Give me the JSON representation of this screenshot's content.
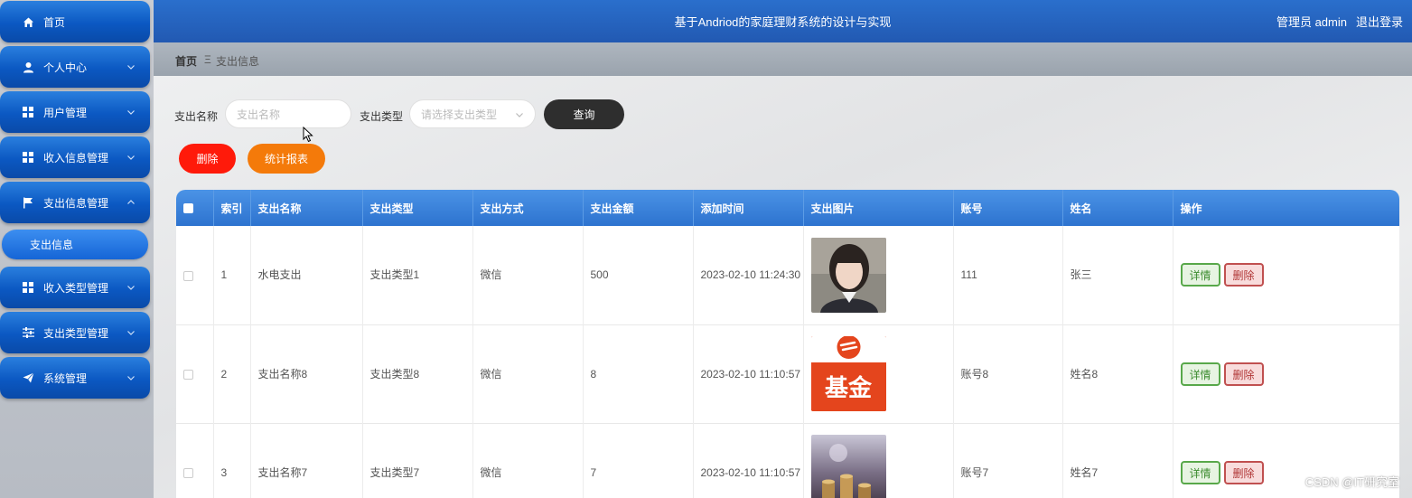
{
  "sidebar": {
    "items": [
      {
        "label": "首页",
        "icon": "home-icon"
      },
      {
        "label": "个人中心",
        "icon": "user-icon"
      },
      {
        "label": "用户管理",
        "icon": "grid-icon"
      },
      {
        "label": "收入信息管理",
        "icon": "grid-icon"
      },
      {
        "label": "支出信息管理",
        "icon": "flag-icon"
      },
      {
        "label": "收入类型管理",
        "icon": "grid-icon"
      },
      {
        "label": "支出类型管理",
        "icon": "sliders-icon"
      },
      {
        "label": "系统管理",
        "icon": "send-icon"
      }
    ],
    "active_sub": "支出信息"
  },
  "header": {
    "title": "基于Andriod的家庭理财系统的设计与实现",
    "user": "管理员 admin",
    "logout": "退出登录"
  },
  "breadcrumb": {
    "home": "首页",
    "sep": "Ξ",
    "current": "支出信息"
  },
  "search": {
    "name_label": "支出名称",
    "name_placeholder": "支出名称",
    "type_label": "支出类型",
    "type_placeholder": "请选择支出类型",
    "query_button": "查询"
  },
  "actions": {
    "delete": "删除",
    "report": "统计报表"
  },
  "table": {
    "headers": [
      "索引",
      "支出名称",
      "支出类型",
      "支出方式",
      "支出金额",
      "添加时间",
      "支出图片",
      "账号",
      "姓名",
      "操作"
    ],
    "rows": [
      {
        "index": "1",
        "name": "水电支出",
        "type": "支出类型1",
        "method": "微信",
        "amount": "500",
        "time": "2023-02-10 11:24:30",
        "account": "111",
        "person": "张三"
      },
      {
        "index": "2",
        "name": "支出名称8",
        "type": "支出类型8",
        "method": "微信",
        "amount": "8",
        "time": "2023-02-10 11:10:57",
        "account": "账号8",
        "person": "姓名8"
      },
      {
        "index": "3",
        "name": "支出名称7",
        "type": "支出类型7",
        "method": "微信",
        "amount": "7",
        "time": "2023-02-10 11:10:57",
        "account": "账号7",
        "person": "姓名7"
      }
    ],
    "op_detail": "详情",
    "op_delete": "删除"
  },
  "fund_image_text": "基金",
  "watermark": "CSDN @IT研究室",
  "colors": {
    "primary_blue": "#0b58c2",
    "delete_red": "#ff1a0a",
    "report_orange": "#f47a0a",
    "query_dark": "#2e2e2e"
  }
}
